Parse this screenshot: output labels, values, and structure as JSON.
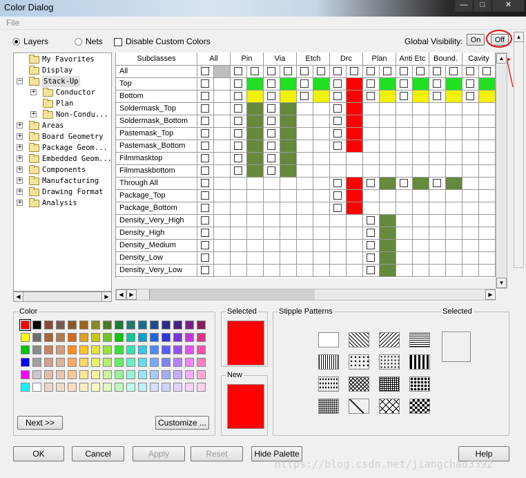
{
  "window": {
    "title": "Color Dialog"
  },
  "menu": {
    "file": "File"
  },
  "mode": {
    "layers": "Layers",
    "nets": "Nets",
    "selected": "layers"
  },
  "disable_custom": "Disable Custom Colors",
  "global_visibility": {
    "label": "Global Visibility:",
    "on": "On",
    "off": "Off"
  },
  "tree": [
    {
      "label": "My Favorites",
      "level": 0,
      "expander": "",
      "open": false
    },
    {
      "label": "Display",
      "level": 0,
      "expander": "",
      "open": false
    },
    {
      "label": "Stack-Up",
      "level": 0,
      "expander": "-",
      "open": true
    },
    {
      "label": "Conductor",
      "level": 1,
      "expander": "+",
      "open": false
    },
    {
      "label": "Plan",
      "level": 1,
      "expander": "",
      "open": false
    },
    {
      "label": "Non-Condu...",
      "level": 1,
      "expander": "+",
      "open": false
    },
    {
      "label": "Areas",
      "level": 0,
      "expander": "+",
      "open": false
    },
    {
      "label": "Board Geometry",
      "level": 0,
      "expander": "+",
      "open": false
    },
    {
      "label": "Package Geom...",
      "level": 0,
      "expander": "+",
      "open": false
    },
    {
      "label": "Embedded Geom...",
      "level": 0,
      "expander": "+",
      "open": false
    },
    {
      "label": "Components",
      "level": 0,
      "expander": "+",
      "open": false
    },
    {
      "label": "Manufacturing",
      "level": 0,
      "expander": "+",
      "open": false
    },
    {
      "label": "Drawing Format",
      "level": 0,
      "expander": "+",
      "open": false
    },
    {
      "label": "Analysis",
      "level": 0,
      "expander": "+",
      "open": false
    }
  ],
  "grid": {
    "header": [
      "Subclasses",
      "All",
      "Pin",
      "Via",
      "Etch",
      "Drc",
      "Plan",
      "Anti Etc",
      "Bound.",
      "Cavity"
    ],
    "colors": {
      "G": "#21e021",
      "Y": "#f2f200",
      "R": "#ff0000",
      "O": "#65893d",
      "S": "#bdbdbd"
    },
    "rows": [
      {
        "name": "All",
        "cells": [
          "c0",
          "cS",
          "c0",
          "c0",
          "c0",
          "c0",
          "c0",
          "c0",
          "c0",
          "c0",
          "c0",
          "c0",
          "c0",
          "c0",
          "c0",
          "c0",
          "c0",
          "c0"
        ]
      },
      {
        "name": "Top",
        "cells": [
          "c0",
          "",
          "c0",
          "cG",
          "c0",
          "cG",
          "c0",
          "cG",
          "c0",
          "cR",
          "c0",
          "cG",
          "c0",
          "cG",
          "c0",
          "cG",
          "c0",
          "cG"
        ]
      },
      {
        "name": "Bottom",
        "cells": [
          "c0",
          "",
          "c0",
          "cY",
          "c0",
          "cY",
          "c0",
          "cY",
          "c0",
          "cR",
          "c0",
          "cY",
          "c0",
          "cY",
          "c0",
          "cY",
          "c0",
          "cY"
        ]
      },
      {
        "name": "Soldermask_Top",
        "cells": [
          "c0",
          "",
          "c0",
          "O",
          "c0",
          "O",
          "",
          "",
          "c0",
          "R",
          "",
          "",
          "",
          "",
          "",
          "",
          "",
          ""
        ]
      },
      {
        "name": "Soldermask_Bottom",
        "cells": [
          "c0",
          "",
          "c0",
          "O",
          "c0",
          "O",
          "",
          "",
          "c0",
          "R",
          "",
          "",
          "",
          "",
          "",
          "",
          "",
          ""
        ]
      },
      {
        "name": "Pastemask_Top",
        "cells": [
          "c0",
          "",
          "c0",
          "O",
          "c0",
          "O",
          "",
          "",
          "c0",
          "R",
          "",
          "",
          "",
          "",
          "",
          "",
          "",
          ""
        ]
      },
      {
        "name": "Pastemask_Bottom",
        "cells": [
          "c0",
          "",
          "c0",
          "O",
          "c0",
          "O",
          "",
          "",
          "c0",
          "R",
          "",
          "",
          "",
          "",
          "",
          "",
          "",
          ""
        ]
      },
      {
        "name": "Filmmasktop",
        "cells": [
          "c0",
          "",
          "c0",
          "O",
          "c0",
          "O",
          "",
          "",
          "",
          "",
          "",
          "",
          "",
          "",
          "",
          "",
          "",
          ""
        ]
      },
      {
        "name": "Filmmaskbottom",
        "cells": [
          "c0",
          "",
          "c0",
          "O",
          "c0",
          "O",
          "",
          "",
          "",
          "",
          "",
          "",
          "",
          "",
          "",
          "",
          "",
          ""
        ]
      },
      {
        "name": "Through All",
        "cells": [
          "c0",
          "",
          "",
          "",
          "",
          "",
          "",
          "",
          "c0",
          "R",
          "c0",
          "O",
          "c0",
          "O",
          "c0",
          "O",
          "",
          ""
        ]
      },
      {
        "name": "Package_Top",
        "cells": [
          "c0",
          "",
          "",
          "",
          "",
          "",
          "",
          "",
          "c0",
          "R",
          "",
          "",
          "",
          "",
          "",
          "",
          "",
          ""
        ]
      },
      {
        "name": "Package_Bottom",
        "cells": [
          "c0",
          "",
          "",
          "",
          "",
          "",
          "",
          "",
          "c0",
          "R",
          "",
          "",
          "",
          "",
          "",
          "",
          "",
          ""
        ]
      },
      {
        "name": "Density_Very_High",
        "cells": [
          "c0",
          "",
          "",
          "",
          "",
          "",
          "",
          "",
          "",
          "",
          "c0",
          "O",
          "",
          "",
          "",
          "",
          "",
          ""
        ]
      },
      {
        "name": "Density_High",
        "cells": [
          "c0",
          "",
          "",
          "",
          "",
          "",
          "",
          "",
          "",
          "",
          "c0",
          "O",
          "",
          "",
          "",
          "",
          "",
          ""
        ]
      },
      {
        "name": "Density_Medium",
        "cells": [
          "c0",
          "",
          "",
          "",
          "",
          "",
          "",
          "",
          "",
          "",
          "c0",
          "O",
          "",
          "",
          "",
          "",
          "",
          ""
        ]
      },
      {
        "name": "Density_Low",
        "cells": [
          "c0",
          "",
          "",
          "",
          "",
          "",
          "",
          "",
          "",
          "",
          "c0",
          "O",
          "",
          "",
          "",
          "",
          "",
          ""
        ]
      },
      {
        "name": "Density_Very_Low",
        "cells": [
          "c0",
          "",
          "",
          "",
          "",
          "",
          "",
          "",
          "",
          "",
          "c0",
          "O",
          "",
          "",
          "",
          "",
          "",
          ""
        ]
      }
    ]
  },
  "color_section": {
    "title": "Color",
    "palette": [
      [
        "#ff0000",
        "#000000",
        "#8b4a3a",
        "#7a5a50",
        "#8b5a2b",
        "#a06418",
        "#8b8b1e",
        "#4b7a1e",
        "#1e7a3a",
        "#1e7a6e",
        "#1e6e8b",
        "#1e4a8b",
        "#2b2b8b",
        "#4a1e8b",
        "#7a1e8b",
        "#8b1e5a"
      ],
      [
        "#ffff00",
        "#6e6e6e",
        "#a8643a",
        "#b47850",
        "#d2691e",
        "#e0a020",
        "#c8c800",
        "#6ec81e",
        "#00c800",
        "#00c896",
        "#00a0c8",
        "#1e64e0",
        "#3232e0",
        "#7a32e0",
        "#c832e0",
        "#e0328c"
      ],
      [
        "#00c800",
        "#8c8c8c",
        "#c88264",
        "#d2a07a",
        "#ff8c1e",
        "#ffc81e",
        "#e6e632",
        "#96e632",
        "#32e632",
        "#32e6b4",
        "#32c8e6",
        "#4b8cff",
        "#5a5aff",
        "#9650ff",
        "#e650ff",
        "#ff50aa"
      ],
      [
        "#0000ff",
        "#a0a0a0",
        "#d2a08c",
        "#dcb49a",
        "#ffaa64",
        "#ffd764",
        "#f0f064",
        "#b4f064",
        "#64f064",
        "#64f0c8",
        "#64dcf0",
        "#7aaaff",
        "#8282ff",
        "#b482ff",
        "#f082ff",
        "#ff82c3"
      ],
      [
        "#ff00ff",
        "#c8c8c8",
        "#e0beaa",
        "#e6c8b4",
        "#ffc896",
        "#ffe696",
        "#f5f596",
        "#c8f596",
        "#96f596",
        "#96f5dc",
        "#96e6f5",
        "#aac8ff",
        "#aaaaff",
        "#c8aaff",
        "#f5aaff",
        "#ffaad7"
      ],
      [
        "#00ffff",
        "#ffffff",
        "#ecd6c8",
        "#f0dccd",
        "#ffdcbe",
        "#fff0be",
        "#fafabe",
        "#dcfabe",
        "#befabe",
        "#befaeb",
        "#bef0fa",
        "#d2e1ff",
        "#d2d2ff",
        "#e1d2ff",
        "#fad2ff",
        "#ffd2eb"
      ]
    ],
    "selected_label": "Selected",
    "selected_color": "#ff0000",
    "new_label": "New",
    "new_color": "#ff0000",
    "next_btn": "Next >>",
    "customize_btn": "Customize ..."
  },
  "stipple": {
    "title": "Stipple Patterns",
    "selected_label": "Selected"
  },
  "buttons": {
    "ok": "OK",
    "cancel": "Cancel",
    "apply": "Apply",
    "reset": "Reset",
    "hide_palette": "Hide Palette",
    "help": "Help"
  },
  "watermark": "https://blog.csdn.net/jiangchao3392"
}
